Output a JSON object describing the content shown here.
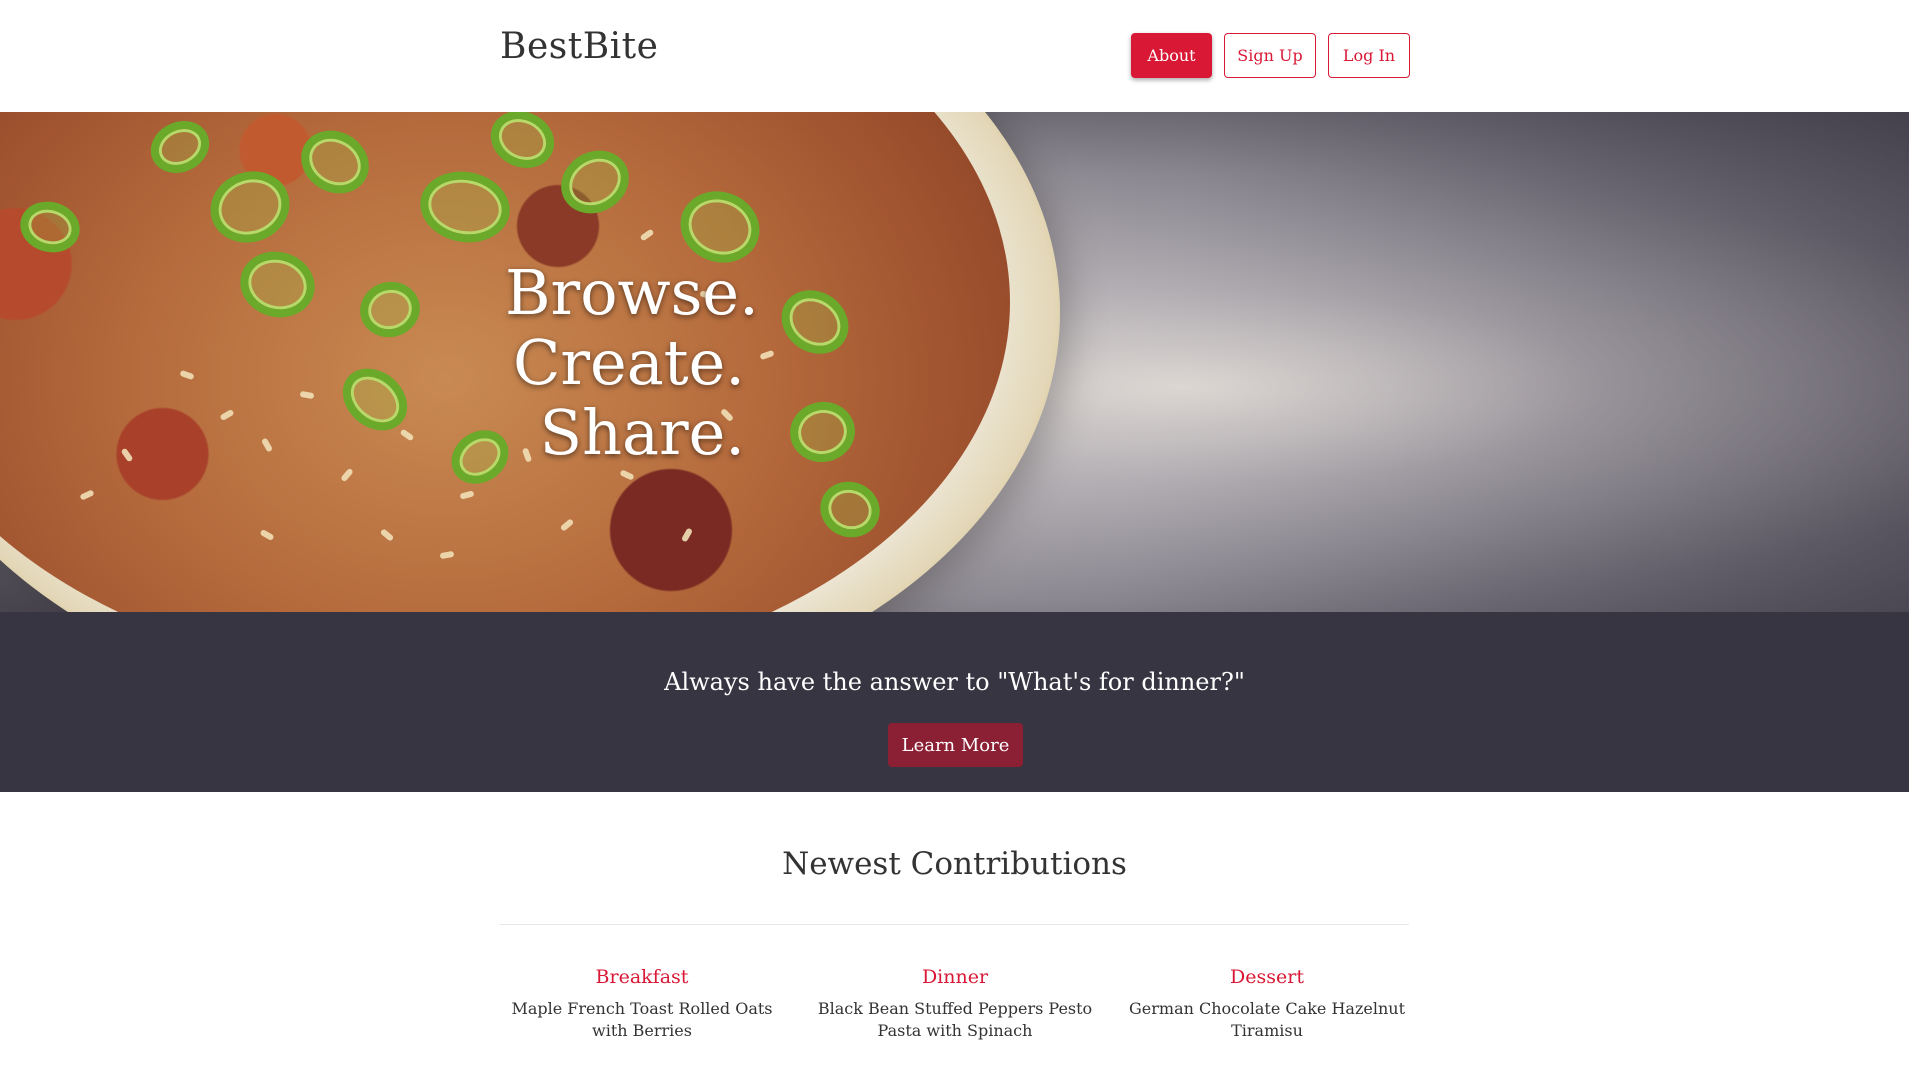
{
  "header": {
    "brand": "BestBite",
    "nav": {
      "about": "About",
      "signup": "Sign Up",
      "login": "Log In"
    }
  },
  "hero": {
    "lines": [
      "Browse.",
      "Create.",
      "Share."
    ]
  },
  "band": {
    "text": "Always have the answer to \"What's for dinner?\"",
    "button": "Learn More"
  },
  "contributions": {
    "title": "Newest Contributions",
    "columns": [
      {
        "category": "Breakfast",
        "recipe": "Maple French Toast Rolled Oats with Berries"
      },
      {
        "category": "Dinner",
        "recipe": "Black Bean Stuffed Peppers Pesto Pasta with Spinach"
      },
      {
        "category": "Dessert",
        "recipe": "German Chocolate Cake Hazelnut Tiramisu"
      }
    ]
  },
  "colors": {
    "accent": "#d81834",
    "band_bg": "#373542",
    "learn_more_bg": "#8b2034"
  }
}
